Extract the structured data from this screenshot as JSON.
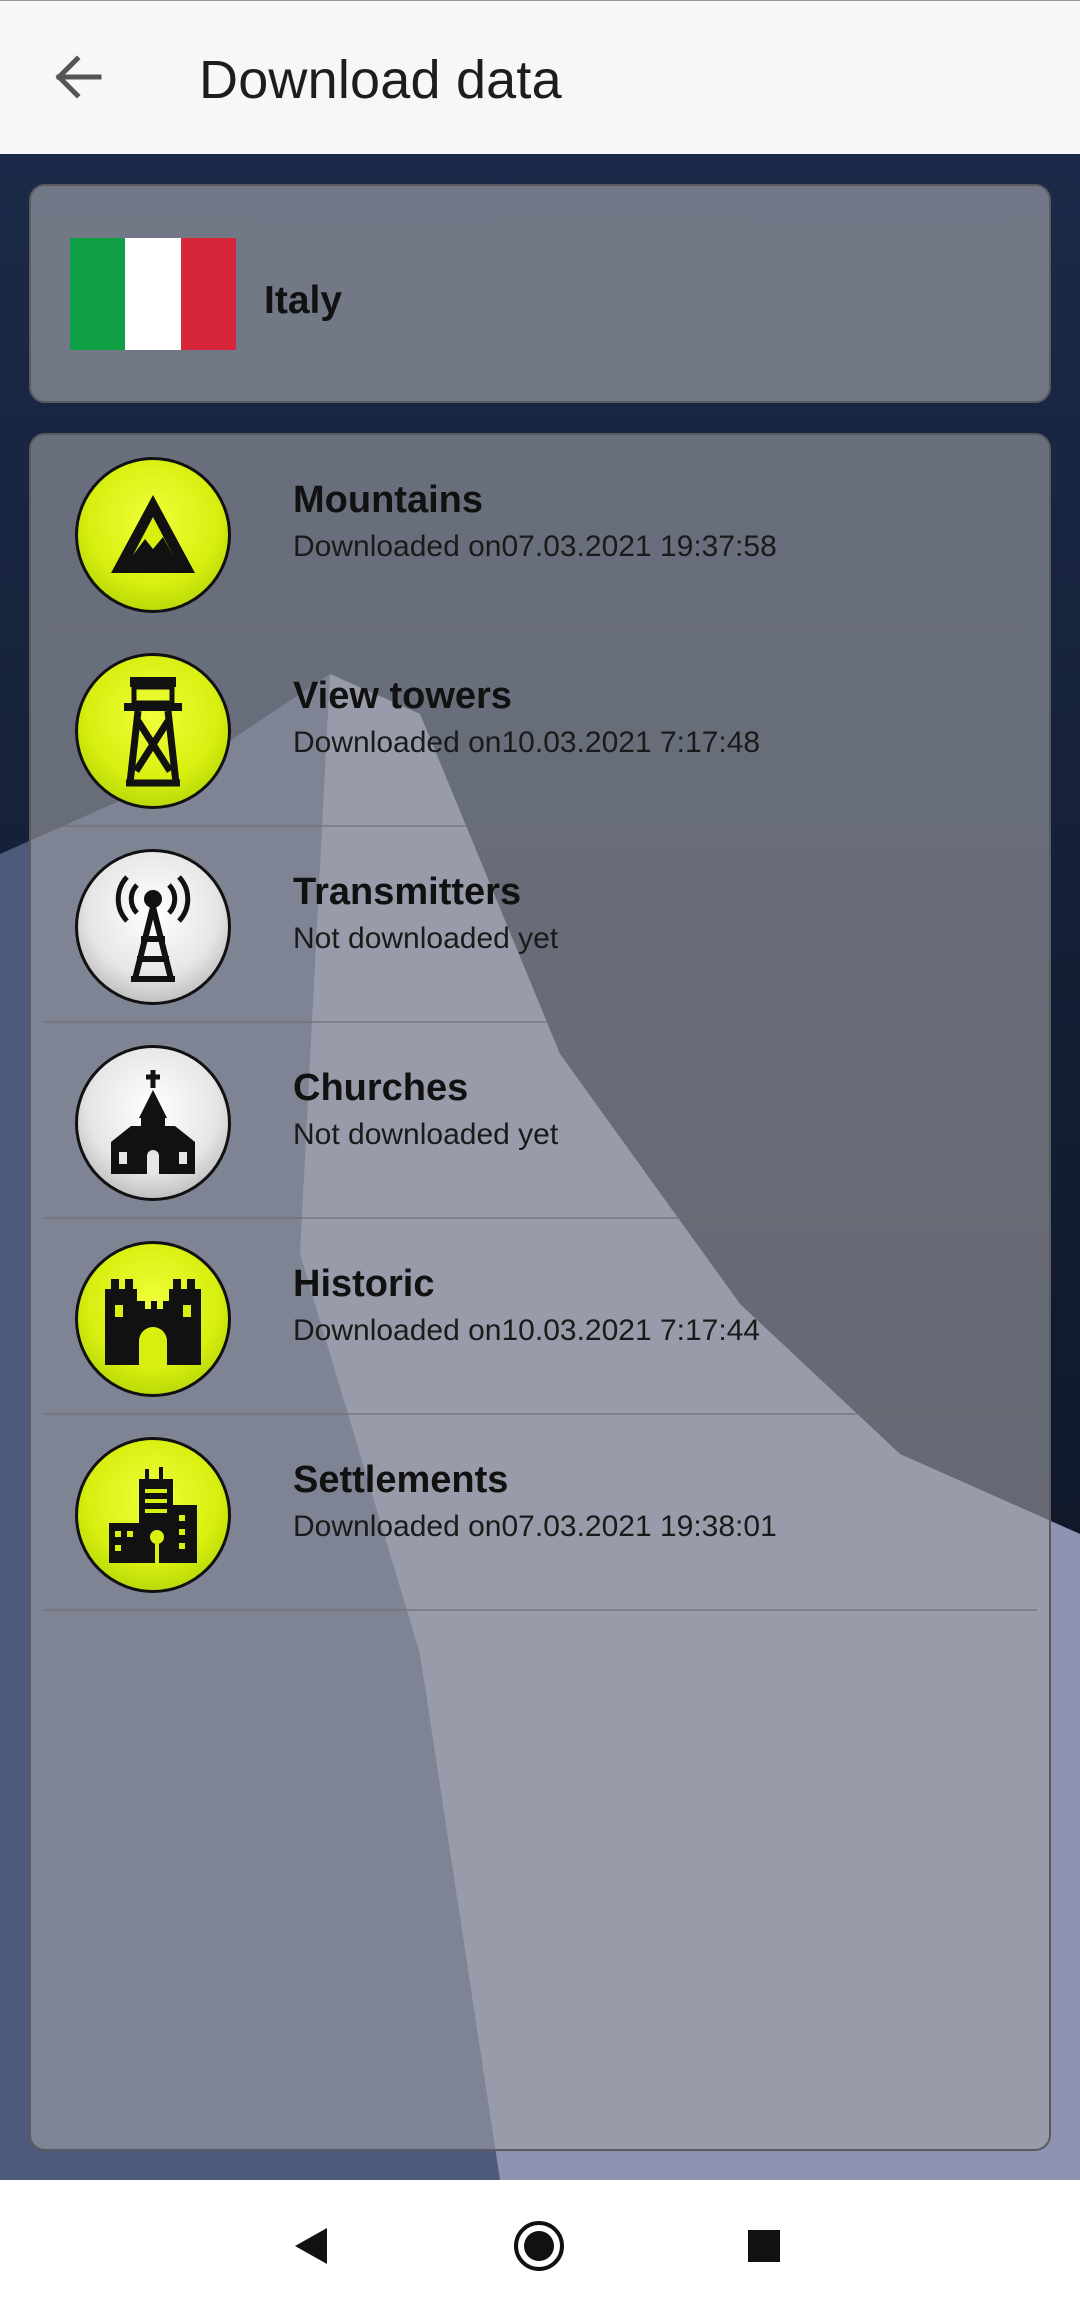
{
  "app": {
    "title": "Download data"
  },
  "country": {
    "name": "Italy",
    "flag_colors": [
      "#119f45",
      "#ffffff",
      "#d6273a"
    ]
  },
  "categories": [
    {
      "name": "Mountains",
      "status": "Downloaded on07.03.2021 19:37:58",
      "downloaded": true,
      "icon": "mountain-icon"
    },
    {
      "name": "View towers",
      "status": "Downloaded on10.03.2021 7:17:48",
      "downloaded": true,
      "icon": "tower-icon"
    },
    {
      "name": "Transmitters",
      "status": "Not downloaded yet",
      "downloaded": false,
      "icon": "transmitter-icon"
    },
    {
      "name": "Churches",
      "status": "Not downloaded yet",
      "downloaded": false,
      "icon": "church-icon"
    },
    {
      "name": "Historic",
      "status": "Downloaded on10.03.2021 7:17:44",
      "downloaded": true,
      "icon": "castle-icon"
    },
    {
      "name": "Settlements",
      "status": "Downloaded on07.03.2021 19:38:01",
      "downloaded": true,
      "icon": "buildings-icon"
    }
  ],
  "colors": {
    "downloaded": "#d8ef10",
    "not_downloaded": "#e6e6e6"
  }
}
